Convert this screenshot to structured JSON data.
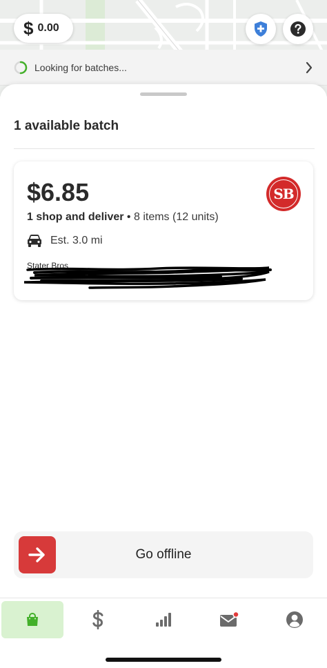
{
  "header": {
    "earnings": {
      "currency_icon": "dollar-icon",
      "amount": "0.00"
    },
    "shield_icon": "shield-plus-icon",
    "help_icon": "question-circle-icon"
  },
  "status": {
    "text": "Looking for batches...",
    "accent": "#43b02a"
  },
  "sheet": {
    "title": "1 available batch"
  },
  "batch": {
    "price": "$6.85",
    "type": "1 shop and deliver",
    "separator": " • ",
    "items": "8 items (12 units)",
    "distance": "Est. 3.0 mi",
    "store_name": "Stater Bros",
    "store_logo_text": "SB",
    "store_color": "#d32a2a"
  },
  "actions": {
    "go_offline_label": "Go offline",
    "go_offline_color": "#d73a3a"
  },
  "nav": {
    "items": [
      {
        "icon": "shopping-bag-icon",
        "active": true
      },
      {
        "icon": "dollar-icon",
        "active": false
      },
      {
        "icon": "bar-chart-icon",
        "active": false
      },
      {
        "icon": "mail-icon",
        "active": false,
        "badge": true
      },
      {
        "icon": "account-icon",
        "active": false
      }
    ],
    "active_color": "#43b02a"
  }
}
